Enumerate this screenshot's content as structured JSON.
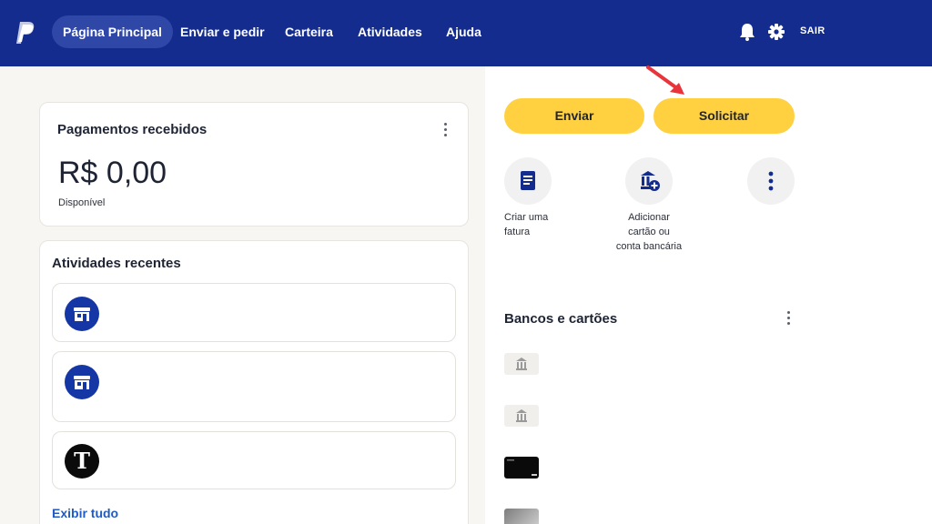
{
  "nav": {
    "items": [
      "Página Principal",
      "Enviar e pedir",
      "Carteira",
      "Atividades",
      "Ajuda"
    ],
    "logout": "SAIR"
  },
  "payments": {
    "title": "Pagamentos recebidos",
    "amount": "R$ 0,00",
    "label": "Disponível"
  },
  "activities": {
    "title": "Atividades recentes",
    "nyt_glyph": "T",
    "see_all": "Exibir tudo"
  },
  "actions": {
    "send": "Enviar",
    "request": "Solicitar",
    "quick": [
      {
        "icon": "invoice-icon",
        "label": "Criar uma fatura"
      },
      {
        "icon": "add-bank-icon",
        "label": "Adicionar cartão ou conta bancária"
      },
      {
        "icon": "more-icon",
        "label": ""
      }
    ]
  },
  "banks": {
    "title": "Bancos e cartões"
  },
  "colors": {
    "nav_bg": "#142c8e",
    "nav_active": "#2f47a7",
    "button_yellow": "#ffd140",
    "link_blue": "#1f5bc4",
    "annotation_arrow": "#e8343a"
  }
}
